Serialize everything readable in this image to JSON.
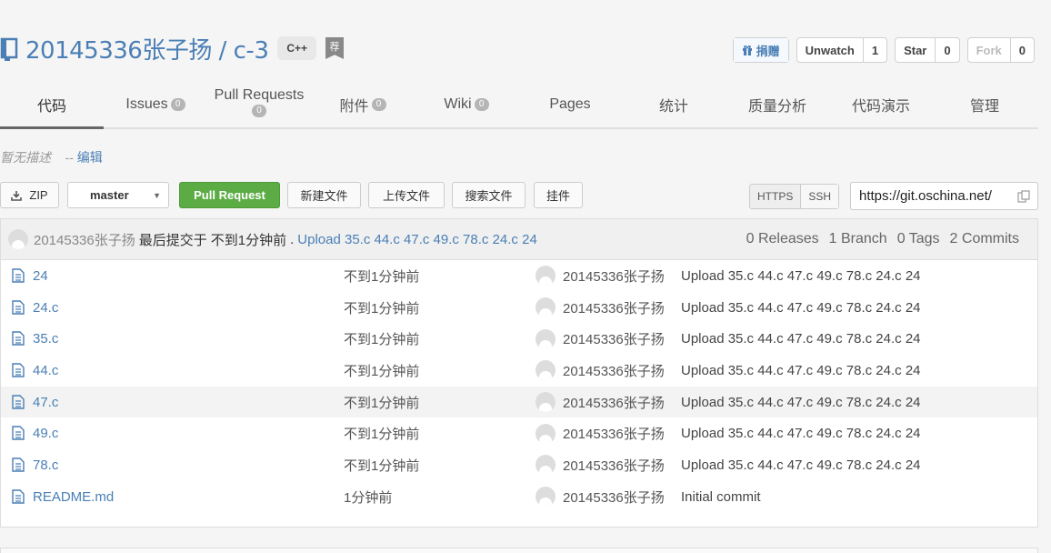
{
  "repo": {
    "owner": "20145336张子扬",
    "separator": " / ",
    "name": "c-3",
    "language": "C++",
    "recommend_badge": "荐"
  },
  "actions": {
    "donate_label": "捐赠",
    "unwatch_label": "Unwatch",
    "unwatch_count": "1",
    "star_label": "Star",
    "star_count": "0",
    "fork_label": "Fork",
    "fork_count": "0"
  },
  "tabs": [
    {
      "label": "代码",
      "badge": null
    },
    {
      "label": "Issues",
      "badge": "0"
    },
    {
      "label": "Pull Requests",
      "badge": "0"
    },
    {
      "label": "附件",
      "badge": "0"
    },
    {
      "label": "Wiki",
      "badge": "0"
    },
    {
      "label": "Pages",
      "badge": null
    },
    {
      "label": "统计",
      "badge": null
    },
    {
      "label": "质量分析",
      "badge": null
    },
    {
      "label": "代码演示",
      "badge": null
    },
    {
      "label": "管理",
      "badge": null
    }
  ],
  "description": {
    "empty_text": "暂无描述",
    "separator": "--",
    "edit_label": "编辑"
  },
  "toolbar": {
    "zip_label": "ZIP",
    "branch": "master",
    "pull_request_label": "Pull Request",
    "new_file_label": "新建文件",
    "upload_label": "上传文件",
    "search_label": "搜索文件",
    "widget_label": "挂件",
    "https_label": "HTTPS",
    "ssh_label": "SSH",
    "clone_url": "https://git.oschina.net/"
  },
  "last_commit": {
    "author": "20145336张子扬",
    "prefix": "最后提交于",
    "time": "不到1分钟前",
    "dot": ".",
    "message": "Upload 35.c 44.c 47.c 49.c 78.c 24.c 24",
    "releases": "0 Releases",
    "branches": "1 Branch",
    "tags": "0 Tags",
    "commits": "2 Commits"
  },
  "files": [
    {
      "name": "24",
      "time": "不到1分钟前",
      "author": "20145336张子扬",
      "message": "Upload 35.c 44.c 47.c 49.c 78.c 24.c 24"
    },
    {
      "name": "24.c",
      "time": "不到1分钟前",
      "author": "20145336张子扬",
      "message": "Upload 35.c 44.c 47.c 49.c 78.c 24.c 24"
    },
    {
      "name": "35.c",
      "time": "不到1分钟前",
      "author": "20145336张子扬",
      "message": "Upload 35.c 44.c 47.c 49.c 78.c 24.c 24"
    },
    {
      "name": "44.c",
      "time": "不到1分钟前",
      "author": "20145336张子扬",
      "message": "Upload 35.c 44.c 47.c 49.c 78.c 24.c 24"
    },
    {
      "name": "47.c",
      "time": "不到1分钟前",
      "author": "20145336张子扬",
      "message": "Upload 35.c 44.c 47.c 49.c 78.c 24.c 24"
    },
    {
      "name": "49.c",
      "time": "不到1分钟前",
      "author": "20145336张子扬",
      "message": "Upload 35.c 44.c 47.c 49.c 78.c 24.c 24"
    },
    {
      "name": "78.c",
      "time": "不到1分钟前",
      "author": "20145336张子扬",
      "message": "Upload 35.c 44.c 47.c 49.c 78.c 24.c 24"
    },
    {
      "name": "README.md",
      "time": "1分钟前",
      "author": "20145336张子扬",
      "message": "Initial commit"
    }
  ],
  "colors": {
    "link": "#4a7fb5",
    "primary_button": "#5cac45",
    "badge": "#b5b5b5"
  }
}
